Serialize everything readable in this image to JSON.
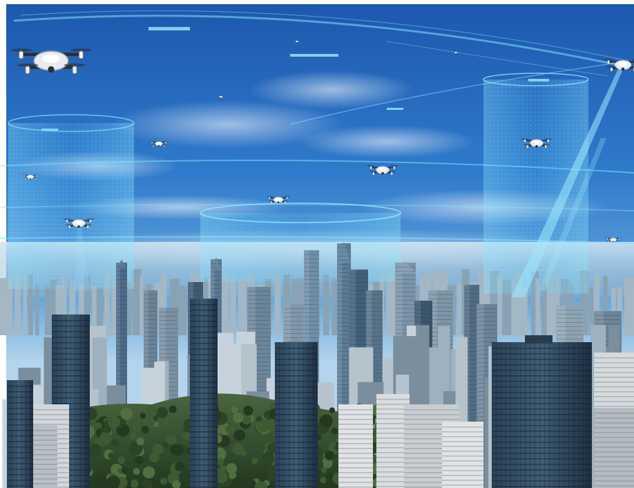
{
  "scene": {
    "description_free": true,
    "palette": {
      "sky_top": "#1f5fb8",
      "sky_mid": "#3a86d4",
      "sky_horizon": "#a9cfe9",
      "haze": "#c9e2f2",
      "hologram": "#5fd3ff",
      "hologram_soft": "#8fe6ff",
      "tower_dark": "#1e3346",
      "tower_mid": "#3b5670",
      "tower_light": "#7d95a8",
      "park_green": "#2f4a2a",
      "park_light": "#4d6b3d",
      "drone_body": "#e8ecef",
      "drone_dark": "#2b2f33"
    },
    "icons": [
      "drone-icon",
      "hologram-cylinder-icon",
      "skyline-icon",
      "park-icon"
    ],
    "drone_count": 12,
    "hologram_cylinder_count": 3
  }
}
